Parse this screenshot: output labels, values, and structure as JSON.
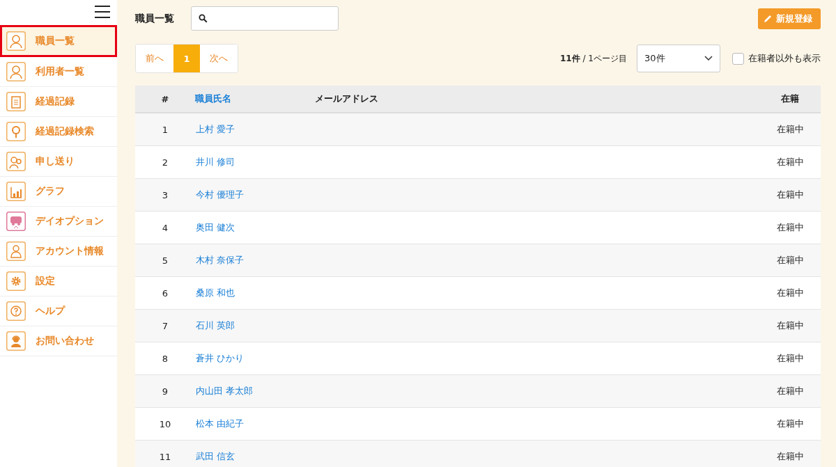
{
  "sidebar": {
    "items": [
      {
        "label": "職員一覧",
        "selected": true
      },
      {
        "label": "利用者一覧",
        "selected": false
      },
      {
        "label": "経過記録",
        "selected": false
      },
      {
        "label": "経過記録検索",
        "selected": false
      },
      {
        "label": "申し送り",
        "selected": false
      },
      {
        "label": "グラフ",
        "selected": false
      },
      {
        "label": "デイオプション",
        "selected": false
      },
      {
        "label": "アカウント情報",
        "selected": false
      },
      {
        "label": "設定",
        "selected": false
      },
      {
        "label": "ヘルプ",
        "selected": false
      },
      {
        "label": "お問い合わせ",
        "selected": false
      }
    ]
  },
  "header": {
    "title": "職員一覧",
    "new_button": "新規登録"
  },
  "pagination": {
    "prev": "前へ",
    "pages": [
      {
        "label": "1",
        "selected": true
      }
    ],
    "next": "次へ"
  },
  "summary": "**11件** / 1ページ目",
  "per_page": {
    "value": "30件"
  },
  "show_inactive": {
    "label": "在籍者以外も表示",
    "checked": false
  },
  "table": {
    "columns": [
      {
        "label": "#",
        "link": false
      },
      {
        "label": "職員氏名",
        "link": true
      },
      {
        "label": "メールアドレス",
        "link": false
      },
      {
        "label": "在籍",
        "link": false
      }
    ],
    "rows": [
      {
        "no": "1",
        "name": "上村 愛子",
        "status": "在籍中"
      },
      {
        "no": "2",
        "name": "井川 修司",
        "status": "在籍中"
      },
      {
        "no": "3",
        "name": "今村 優理子",
        "status": "在籍中"
      },
      {
        "no": "4",
        "name": "奥田 健次",
        "status": "在籍中"
      },
      {
        "no": "5",
        "name": "木村 奈保子",
        "status": "在籍中"
      },
      {
        "no": "6",
        "name": "桑原 和也",
        "status": "在籍中"
      },
      {
        "no": "7",
        "name": "石川 英郎",
        "status": "在籍中"
      },
      {
        "no": "8",
        "name": "蒼井 ひかり",
        "status": "在籍中"
      },
      {
        "no": "9",
        "name": "内山田 孝太郎",
        "status": "在籍中"
      },
      {
        "no": "10",
        "name": "松本 由紀子",
        "status": "在籍中"
      },
      {
        "no": "11",
        "name": "武田 信玄",
        "status": "在籍中"
      }
    ]
  }
}
